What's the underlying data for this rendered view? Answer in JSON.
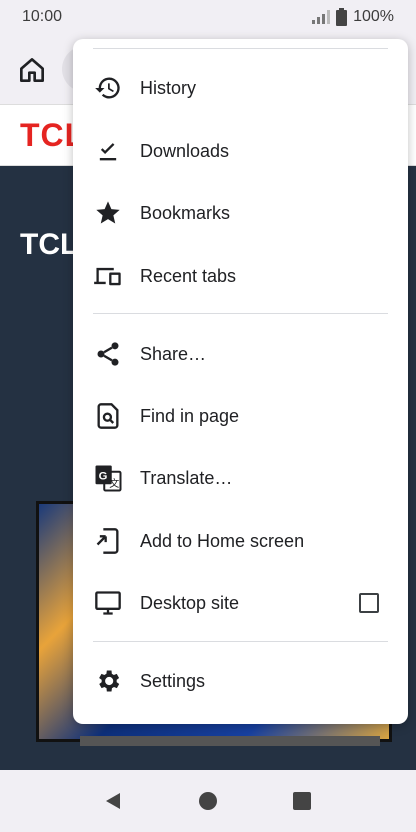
{
  "status_bar": {
    "time": "10:00",
    "battery": "100%"
  },
  "page": {
    "logo": "TCL",
    "hero_title": "TCL"
  },
  "menu": {
    "history": "History",
    "downloads": "Downloads",
    "bookmarks": "Bookmarks",
    "recent_tabs": "Recent tabs",
    "share": "Share…",
    "find_in_page": "Find in page",
    "translate": "Translate…",
    "add_to_home": "Add to Home screen",
    "desktop_site": "Desktop site",
    "desktop_site_checked": false,
    "settings": "Settings"
  },
  "colors": {
    "brand_red": "#e52421",
    "menu_bg": "#ffffff",
    "chrome_bg": "#f1eff4"
  }
}
